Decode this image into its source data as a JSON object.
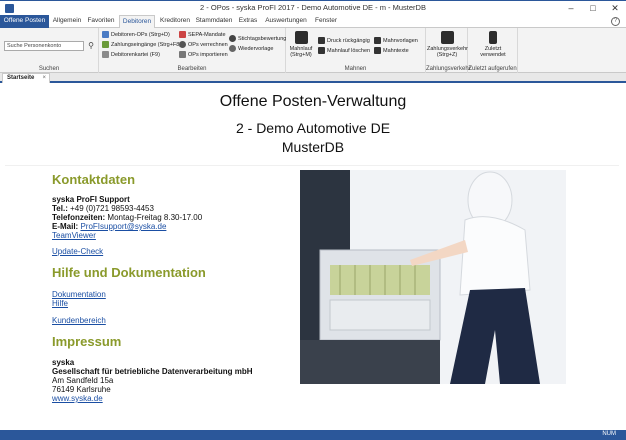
{
  "window": {
    "title": "2 - OPos - syska ProFI 2017 - Demo Automotive DE - m - MusterDB"
  },
  "tabs": {
    "file": "Offene Posten",
    "items": [
      "Allgemein",
      "Favoriten",
      "Debitoren",
      "Kreditoren",
      "Stammdaten",
      "Extras",
      "Auswertungen",
      "Fenster"
    ],
    "active": "Debitoren"
  },
  "ribbon": {
    "search": {
      "placeholder": "Suche Personenkonto",
      "label": "Suchen"
    },
    "bearbeiten": {
      "label": "Bearbeiten",
      "items": [
        "Debitoren-OPs (Strg+D)",
        "Zahlungseingänge (Strg+F8)",
        "Debitorenkartei (F9)",
        "SEPA-Mandate",
        "OPs verrechnen",
        "OPs importieren",
        "Stichtagsbewertung",
        "Wiedervorlage"
      ]
    },
    "mahnen": {
      "label": "Mahnen",
      "mahnlauf": "Mahnlauf (Strg+M)",
      "items": [
        "Druck rückgängig",
        "Mahnlauf löschen",
        "Mahnvorlagen",
        "Mahntexte"
      ]
    },
    "zahlungsverkehr": {
      "label": "Zahlungsverkehr",
      "button": "Zahlungsverkehr (Strg+Z)"
    },
    "zuletzt": {
      "label": "Zuletzt aufgerufen",
      "button": "Zuletzt verwendet"
    }
  },
  "doc_tab": {
    "label": "Startseite"
  },
  "content": {
    "title": "Offene Posten-Verwaltung",
    "company": "2 - Demo Automotive DE",
    "database": "MusterDB",
    "kontakt": {
      "heading": "Kontaktdaten",
      "name": "syska ProFI Support",
      "tel_label": "Tel.:",
      "tel_value": "+49 (0)721 98593-4453",
      "zeiten_label": "Telefonzeiten:",
      "zeiten_value": "Montag-Freitag 8.30-17.00",
      "email_label": "E-Mail:",
      "email_value": "ProFIsupport@syska.de",
      "teamviewer": "TeamViewer",
      "update": "Update-Check"
    },
    "hilfe": {
      "heading": "Hilfe und Dokumentation",
      "doku": "Dokumentation",
      "hilfe": "Hilfe",
      "kunden": "Kundenbereich"
    },
    "impressum": {
      "heading": "Impressum",
      "firma": "syska",
      "firma_full": "Gesellschaft für betriebliche Datenverarbeitung mbH",
      "strasse": "Am Sandfeld 15a",
      "ort": "76149 Karlsruhe",
      "web": "www.syska.de"
    }
  },
  "status": {
    "num": "NUM"
  },
  "colors": {
    "accent": "#2b579a",
    "heading": "#8a9a2b",
    "link": "#1a4ea3"
  }
}
